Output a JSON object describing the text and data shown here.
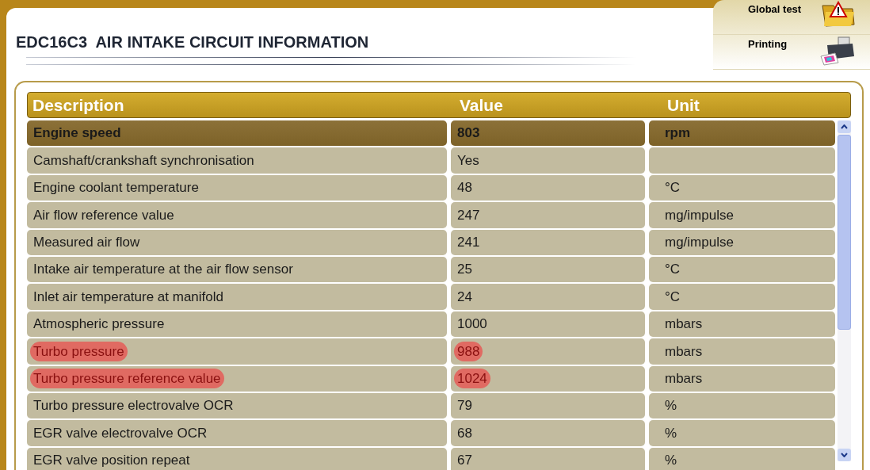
{
  "title": "EDC16C3  AIR INTAKE CIRCUIT INFORMATION",
  "actions": [
    {
      "label": "Global test",
      "kind": "warning"
    },
    {
      "label": "Printing",
      "kind": "printer"
    }
  ],
  "table": {
    "columns": [
      "Description",
      "Value",
      "Unit"
    ],
    "rows": [
      {
        "description": "Engine speed",
        "value": "803",
        "unit": "rpm",
        "selected": true,
        "marked": false
      },
      {
        "description": "Camshaft/crankshaft synchronisation",
        "value": "Yes",
        "unit": "",
        "selected": false,
        "marked": false
      },
      {
        "description": "Engine coolant temperature",
        "value": "48",
        "unit": "°C",
        "selected": false,
        "marked": false
      },
      {
        "description": "Air flow reference value",
        "value": "247",
        "unit": "mg/impulse",
        "selected": false,
        "marked": false
      },
      {
        "description": "Measured air flow",
        "value": "241",
        "unit": "mg/impulse",
        "selected": false,
        "marked": false
      },
      {
        "description": "Intake air temperature at the air flow sensor",
        "value": "25",
        "unit": "°C",
        "selected": false,
        "marked": false
      },
      {
        "description": "Inlet air temperature at manifold",
        "value": "24",
        "unit": "°C",
        "selected": false,
        "marked": false
      },
      {
        "description": "Atmospheric pressure",
        "value": "1000",
        "unit": "mbars",
        "selected": false,
        "marked": false
      },
      {
        "description": "Turbo pressure",
        "value": "988",
        "unit": "mbars",
        "selected": false,
        "marked": true
      },
      {
        "description": "Turbo pressure reference value",
        "value": "1024",
        "unit": "mbars",
        "selected": false,
        "marked": true
      },
      {
        "description": "Turbo pressure electrovalve OCR",
        "value": "79",
        "unit": "%",
        "selected": false,
        "marked": false
      },
      {
        "description": "EGR valve electrovalve OCR",
        "value": "68",
        "unit": "%",
        "selected": false,
        "marked": false
      },
      {
        "description": "EGR valve position repeat",
        "value": "67",
        "unit": "%",
        "selected": false,
        "marked": false
      }
    ]
  }
}
